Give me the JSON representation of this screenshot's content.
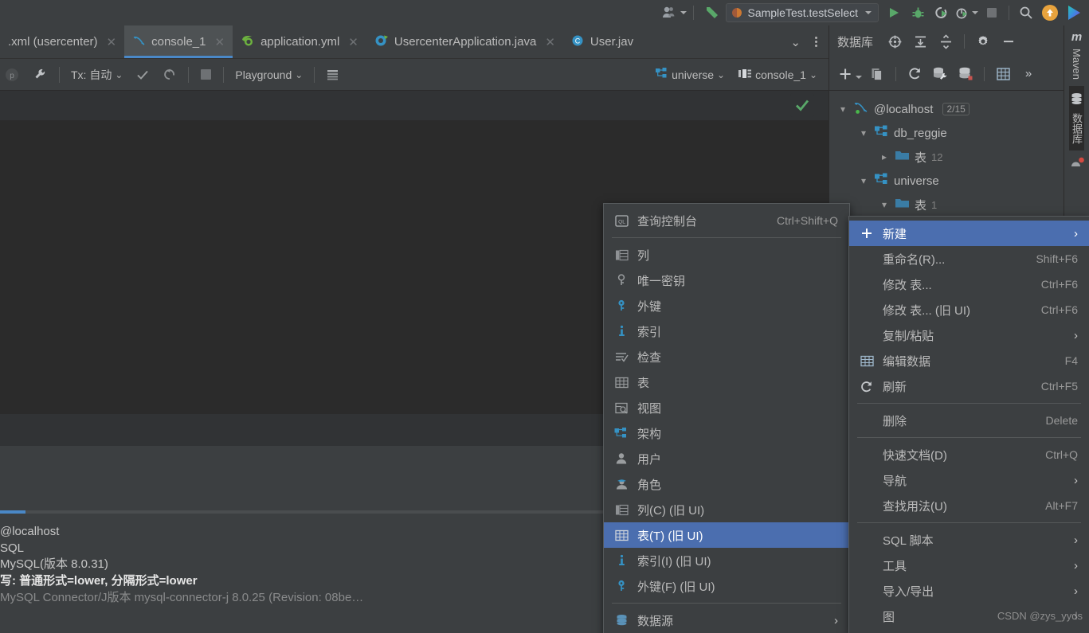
{
  "header": {
    "account_icon": "user-account-icon",
    "back_icon": "back-arrow-icon",
    "run_config": "SampleTest.testSelect",
    "run_icon": "run-icon",
    "debug_icon": "debug-icon",
    "run_with_coverage_icon": "run-with-coverage-icon",
    "profile_icon": "profiler-icon",
    "stop_icon": "stop-icon",
    "search_icon": "search-icon",
    "update_icon": "update-arrow-icon",
    "ai_icon": "ai-assistant-icon"
  },
  "editor_tabs": [
    {
      "label": ".xml (usercenter)",
      "icon": "xml-file-icon",
      "active": false,
      "closable": true
    },
    {
      "label": "console_1",
      "icon": "mysql-console-icon",
      "active": true,
      "closable": true
    },
    {
      "label": "application.yml",
      "icon": "spring-yml-icon",
      "active": false,
      "closable": true
    },
    {
      "label": "UsercenterApplication.java",
      "icon": "spring-class-icon",
      "active": false,
      "closable": true
    },
    {
      "label": "User.jav",
      "icon": "java-class-icon",
      "active": false,
      "closable": false
    }
  ],
  "editor_tabs_right": {
    "chevron_down_icon": "chevron-down-icon",
    "more_icon": "more-vertical-icon"
  },
  "console_toolbar": {
    "pause_icon": "pause-icon",
    "wrench_icon": "wrench-icon",
    "tx_label": "Tx: 自动",
    "commit_icon": "commit-check-icon",
    "rollback_icon": "rollback-icon",
    "stop_icon": "stop-square-icon",
    "schema_label": "Playground",
    "grid_icon": "table-grid-icon",
    "datasource_label": "universe",
    "datasource_icon": "schema-icon",
    "session_label": "console_1",
    "session_icon": "session-icon"
  },
  "editor": {
    "success_icon": "green-check-icon"
  },
  "console_output": {
    "lines": [
      "@localhost",
      "SQL",
      "",
      "MySQL(版本 8.0.31)",
      "写: 普通形式=lower, 分隔形式=lower",
      "MySQL Connector/J版本 mysql-connector-j 8.0.25 (Revision: 08be…"
    ],
    "bold_line_index": 4
  },
  "db_panel": {
    "title": "数据库",
    "head_icons": [
      "locate-target-icon",
      "expand-all-icon",
      "collapse-all-icon",
      "settings-gear-icon",
      "hide-minus-icon"
    ],
    "toolbar_icons": [
      "add-plus-icon",
      "copy-icon",
      "refresh-icon",
      "datasource-properties-icon",
      "sync-db-icon",
      "table-view-icon",
      "more-chevrons-icon"
    ],
    "tree": [
      {
        "depth": 0,
        "chevron": "expanded",
        "icon": "mysql-connection-icon",
        "label": "@localhost",
        "badge": "2/15",
        "count": ""
      },
      {
        "depth": 1,
        "chevron": "expanded",
        "icon": "schema-icon",
        "label": "db_reggie",
        "badge": "",
        "count": ""
      },
      {
        "depth": 2,
        "chevron": "collapsed",
        "icon": "folder-icon",
        "label": "表",
        "badge": "",
        "count": "12"
      },
      {
        "depth": 1,
        "chevron": "expanded",
        "icon": "schema-icon",
        "label": "universe",
        "badge": "",
        "count": ""
      },
      {
        "depth": 2,
        "chevron": "expanded",
        "icon": "folder-icon",
        "label": "表",
        "badge": "",
        "count": "1"
      }
    ]
  },
  "right_stripe": {
    "tabs": [
      {
        "label": "Maven",
        "icon": "maven-icon",
        "selected": false
      },
      {
        "label": "数据库",
        "icon": "database-icon",
        "selected": true
      }
    ],
    "notification_icon": "notification-bell-icon"
  },
  "menu_new_submenu": {
    "items": [
      {
        "label": "查询控制台",
        "accel": "Ctrl+Shift+Q",
        "icon": "query-console-icon",
        "selected": false,
        "arrow": false,
        "separator_after": true
      },
      {
        "label": "列",
        "accel": "",
        "icon": "column-icon",
        "selected": false,
        "arrow": false
      },
      {
        "label": "唯一密钥",
        "accel": "",
        "icon": "unique-key-icon",
        "selected": false,
        "arrow": false
      },
      {
        "label": "外键",
        "accel": "",
        "icon": "foreign-key-icon",
        "selected": false,
        "arrow": false
      },
      {
        "label": "索引",
        "accel": "",
        "icon": "index-icon",
        "selected": false,
        "arrow": false
      },
      {
        "label": "检查",
        "accel": "",
        "icon": "check-constraint-icon",
        "selected": false,
        "arrow": false
      },
      {
        "label": "表",
        "accel": "",
        "icon": "table-icon",
        "selected": false,
        "arrow": false
      },
      {
        "label": "视图",
        "accel": "",
        "icon": "view-icon",
        "selected": false,
        "arrow": false
      },
      {
        "label": "架构",
        "accel": "",
        "icon": "schema-icon",
        "selected": false,
        "arrow": false
      },
      {
        "label": "用户",
        "accel": "",
        "icon": "user-icon",
        "selected": false,
        "arrow": false
      },
      {
        "label": "角色",
        "accel": "",
        "icon": "role-icon",
        "selected": false,
        "arrow": false
      },
      {
        "label": "列(C) (旧 UI)",
        "accel": "",
        "icon": "column-icon",
        "selected": false,
        "arrow": false,
        "mnemonic": "C"
      },
      {
        "label": "表(T) (旧 UI)",
        "accel": "",
        "icon": "table-icon",
        "selected": true,
        "arrow": false,
        "mnemonic": "T"
      },
      {
        "label": "索引(I) (旧 UI)",
        "accel": "",
        "icon": "index-icon",
        "selected": false,
        "arrow": false,
        "mnemonic": "I"
      },
      {
        "label": "外键(F) (旧 UI)",
        "accel": "",
        "icon": "foreign-key-icon",
        "selected": false,
        "arrow": false,
        "mnemonic": "F",
        "separator_after": true
      },
      {
        "label": "数据源",
        "accel": "",
        "icon": "datasource-icon",
        "selected": false,
        "arrow": true
      }
    ]
  },
  "menu_context": {
    "items": [
      {
        "label": "新建",
        "accel": "",
        "icon": "plus-icon",
        "selected": true,
        "arrow": true
      },
      {
        "label": "重命名(R)...",
        "accel": "Shift+F6",
        "icon": "",
        "selected": false,
        "arrow": false,
        "mnemonic": "R"
      },
      {
        "label": "修改 表...",
        "accel": "Ctrl+F6",
        "icon": "",
        "selected": false,
        "arrow": false
      },
      {
        "label": "修改 表... (旧 UI)",
        "accel": "Ctrl+F6",
        "icon": "",
        "selected": false,
        "arrow": false
      },
      {
        "label": "复制/粘贴",
        "accel": "",
        "icon": "",
        "selected": false,
        "arrow": true
      },
      {
        "label": "编辑数据",
        "accel": "F4",
        "icon": "table-icon",
        "selected": false,
        "arrow": false
      },
      {
        "label": "刷新",
        "accel": "Ctrl+F5",
        "icon": "refresh-icon",
        "selected": false,
        "arrow": false,
        "separator_after": true
      },
      {
        "label": "删除",
        "accel": "Delete",
        "icon": "",
        "selected": false,
        "arrow": false,
        "separator_after": true
      },
      {
        "label": "快速文档(D)",
        "accel": "Ctrl+Q",
        "icon": "",
        "selected": false,
        "arrow": false,
        "mnemonic": "D"
      },
      {
        "label": "导航",
        "accel": "",
        "icon": "",
        "selected": false,
        "arrow": true
      },
      {
        "label": "查找用法(U)",
        "accel": "Alt+F7",
        "icon": "",
        "selected": false,
        "arrow": false,
        "mnemonic": "U",
        "separator_after": true
      },
      {
        "label": "SQL 脚本",
        "accel": "",
        "icon": "",
        "selected": false,
        "arrow": true
      },
      {
        "label": "工具",
        "accel": "",
        "icon": "",
        "selected": false,
        "arrow": true
      },
      {
        "label": "导入/导出",
        "accel": "",
        "icon": "",
        "selected": false,
        "arrow": true
      },
      {
        "label": "图",
        "accel": "",
        "icon": "",
        "selected": false,
        "arrow": true
      }
    ]
  },
  "watermark": "CSDN @zys_yyds",
  "colors": {
    "background": "#3c3f41",
    "editor_background": "#2b2b2b",
    "selection_blue": "#4b6eaf",
    "accent_blue": "#4a88c7",
    "icon_blue": "#3592c4",
    "run_green": "#59a869",
    "orange": "#e8a33d"
  }
}
